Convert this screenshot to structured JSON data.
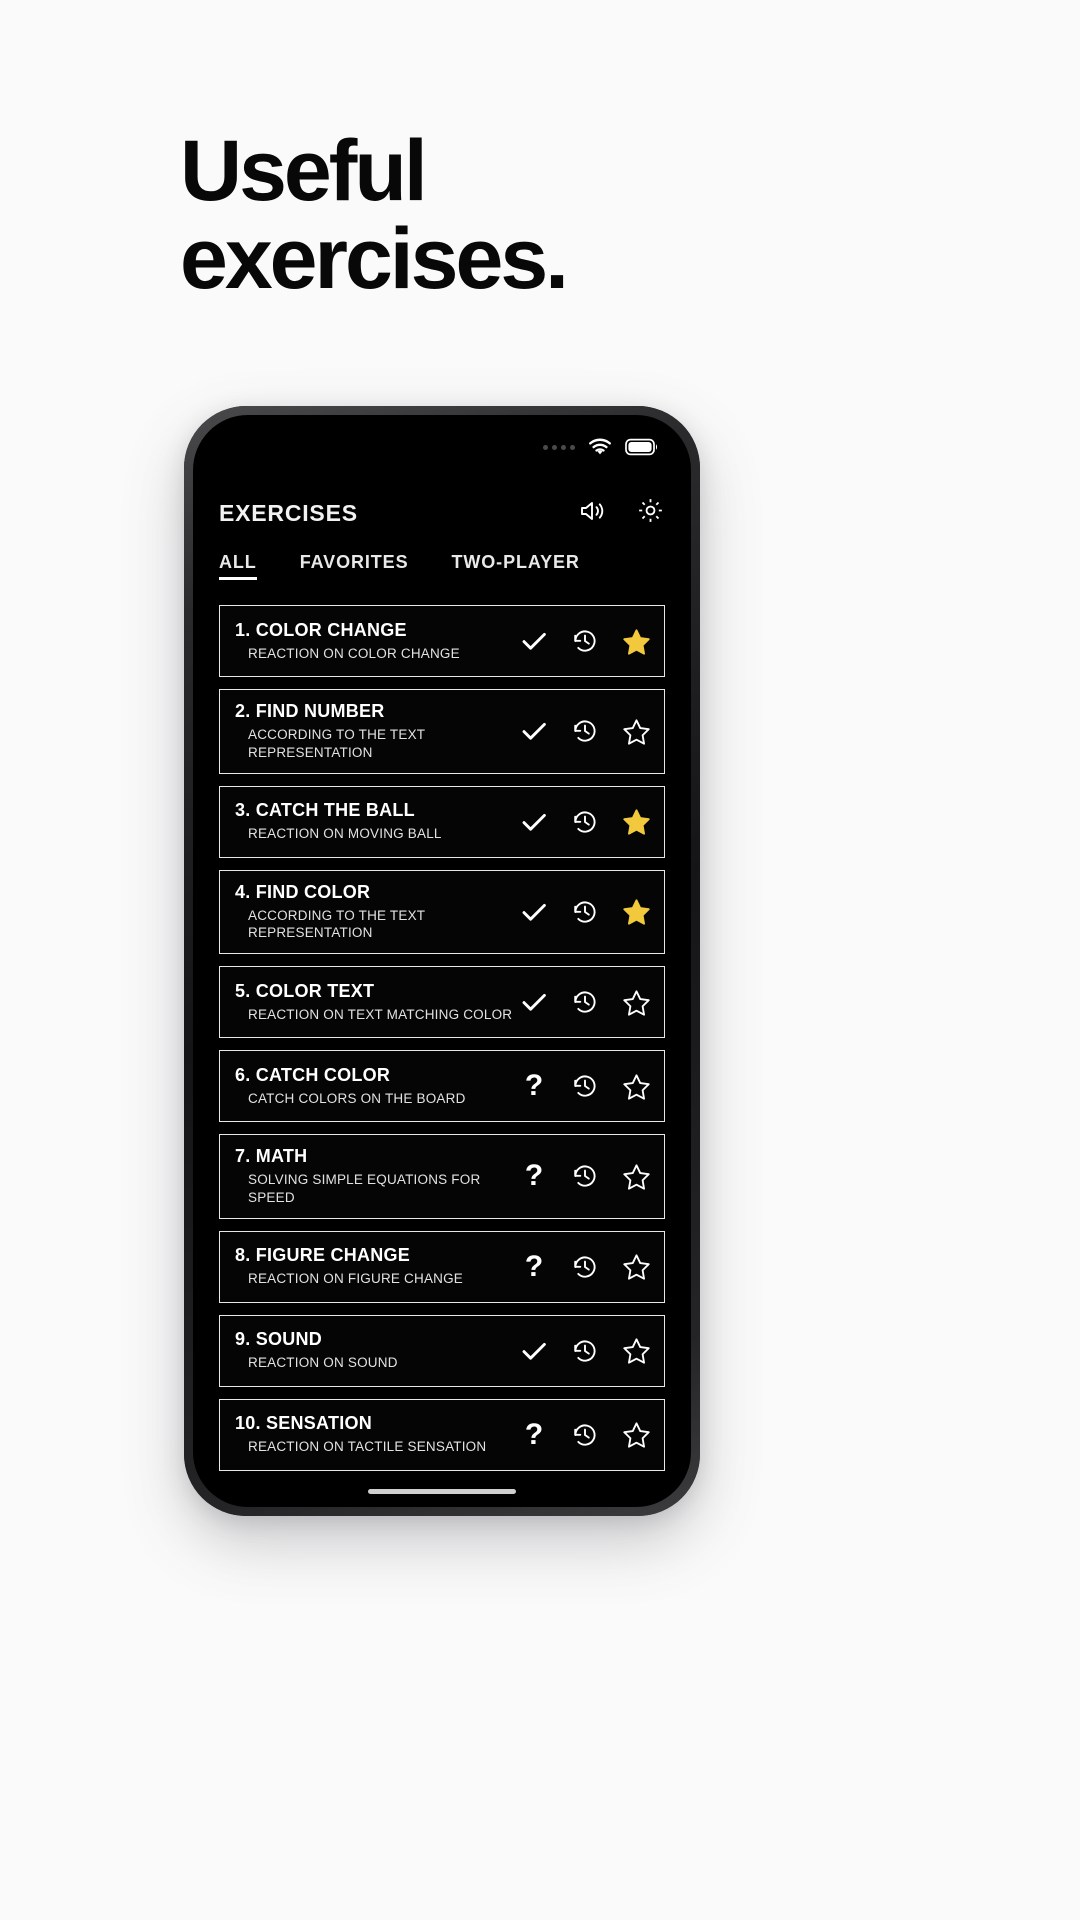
{
  "headline": {
    "line1": "Useful",
    "line2": "exercises."
  },
  "phone": {
    "statusbar": {
      "signal_icon": "signal-dots-icon",
      "wifi_icon": "wifi-icon",
      "battery_icon": "battery-full-icon"
    },
    "header": {
      "title": "EXERCISES",
      "sound_icon": "speaker-volume-icon",
      "settings_icon": "gear-icon"
    },
    "tabs": [
      {
        "label": "ALL",
        "active": true
      },
      {
        "label": "FAVORITES",
        "active": false
      },
      {
        "label": "TWO-PLAYER",
        "active": false
      }
    ],
    "exercises": [
      {
        "title": "1. COLOR CHANGE",
        "subtitle": "REACTION ON COLOR CHANGE",
        "status": "check",
        "history_icon": "history-clock-icon",
        "favorite": true
      },
      {
        "title": "2. FIND NUMBER",
        "subtitle": "ACCORDING TO THE TEXT REPRESENTATION",
        "status": "check",
        "history_icon": "history-clock-icon",
        "favorite": false
      },
      {
        "title": "3. CATCH THE BALL",
        "subtitle": "REACTION ON MOVING BALL",
        "status": "check",
        "history_icon": "history-clock-icon",
        "favorite": true
      },
      {
        "title": "4. FIND COLOR",
        "subtitle": "ACCORDING TO THE TEXT REPRESENTATION",
        "status": "check",
        "history_icon": "history-clock-icon",
        "favorite": true
      },
      {
        "title": "5. COLOR TEXT",
        "subtitle": "REACTION ON TEXT MATCHING COLOR",
        "status": "check",
        "history_icon": "history-clock-icon",
        "favorite": false
      },
      {
        "title": "6. CATCH COLOR",
        "subtitle": "CATCH COLORS ON THE BOARD",
        "status": "question",
        "history_icon": "history-clock-icon",
        "favorite": false
      },
      {
        "title": "7. MATH",
        "subtitle": "SOLVING SIMPLE EQUATIONS FOR SPEED",
        "status": "question",
        "history_icon": "history-clock-icon",
        "favorite": false
      },
      {
        "title": "8. FIGURE CHANGE",
        "subtitle": "REACTION ON FIGURE CHANGE",
        "status": "question",
        "history_icon": "history-clock-icon",
        "favorite": false
      },
      {
        "title": "9. SOUND",
        "subtitle": "REACTION ON SOUND",
        "status": "check",
        "history_icon": "history-clock-icon",
        "favorite": false
      },
      {
        "title": "10. SENSATION",
        "subtitle": "REACTION ON TACTILE SENSATION",
        "status": "question",
        "history_icon": "history-clock-icon",
        "favorite": false
      }
    ],
    "question_glyph": "?"
  },
  "colors": {
    "page_background": "#fafafa",
    "headline_text": "#080808",
    "screen_background": "#000000",
    "border": "#e8e8e8",
    "star_active": "#f2c93c",
    "text_primary": "#ffffff"
  }
}
